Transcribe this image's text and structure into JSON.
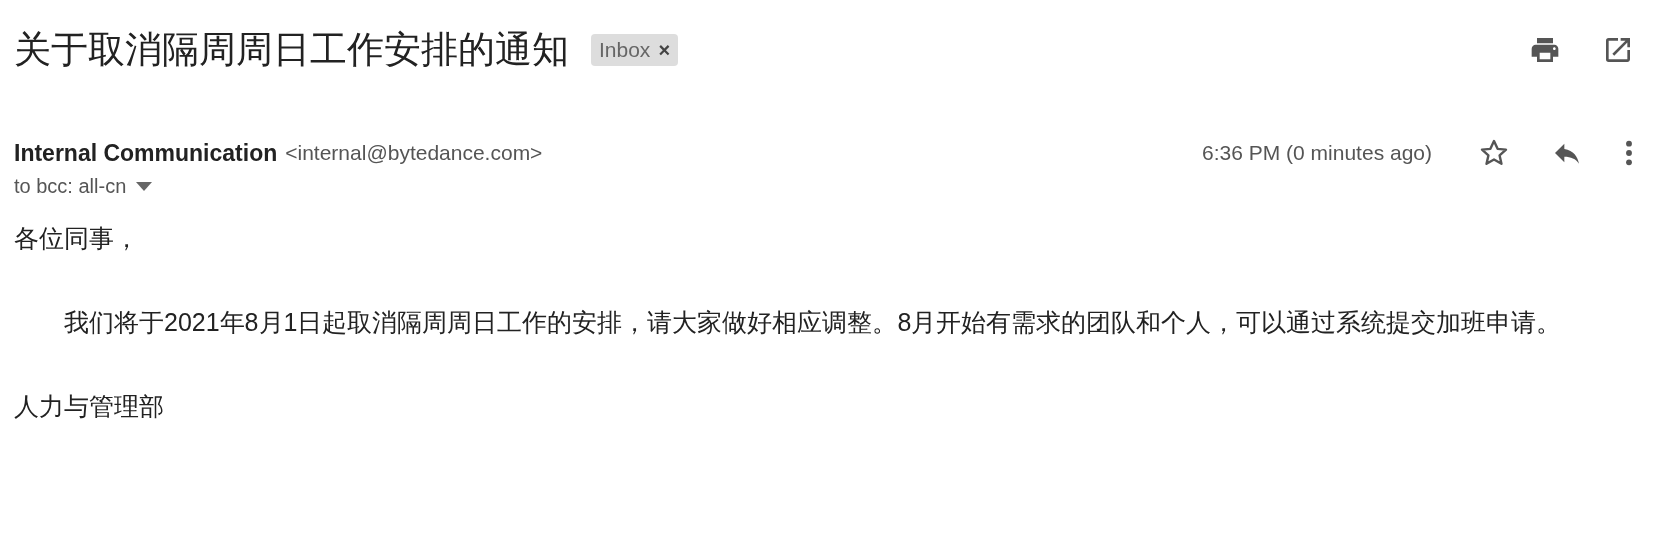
{
  "subject": "关于取消隔周周日工作安排的通知",
  "label": {
    "text": "Inbox",
    "remove": "×"
  },
  "sender": {
    "name": "Internal Communication",
    "email": "<internal@bytedance.com>"
  },
  "time": "6:36 PM (0 minutes ago)",
  "starred": false,
  "recipients": "to bcc: all-cn",
  "body": {
    "greeting": "各位同事，",
    "paragraph": "我们将于2021年8月1日起取消隔周周日工作的安排，请大家做好相应调整。8月开始有需求的团队和个人，可以通过系统提交加班申请。",
    "signature": "人力与管理部"
  }
}
